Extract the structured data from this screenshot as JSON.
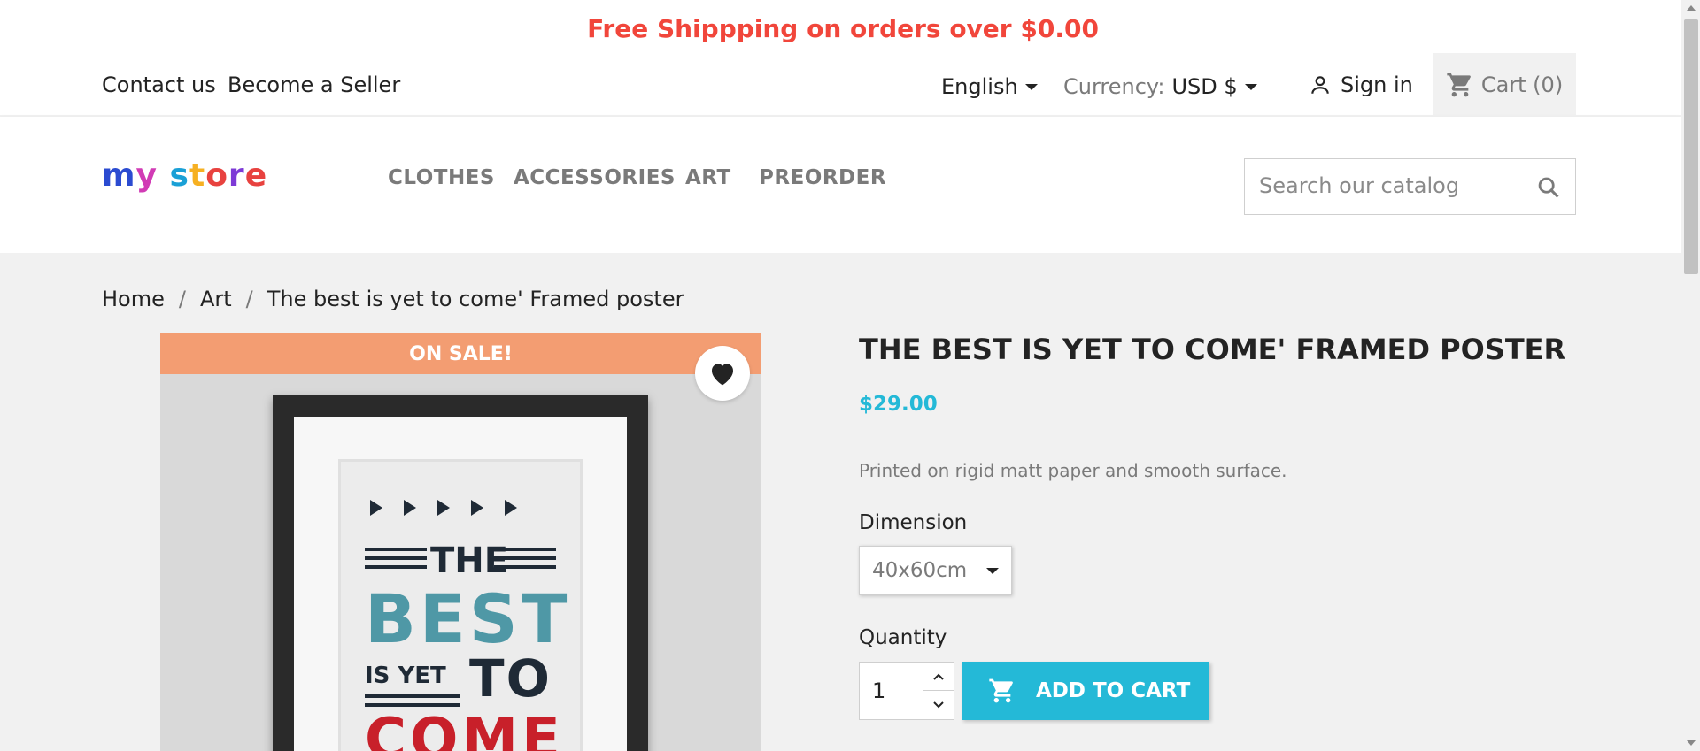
{
  "banner": {
    "text": "Free Shippping on orders over $0.00",
    "color": "#f1463b"
  },
  "top_nav": {
    "links": [
      "Contact us",
      "Become a Seller"
    ],
    "language": "English",
    "currency_label": "Currency:",
    "currency_value": "USD $",
    "signin": "Sign in",
    "cart": "Cart (0)"
  },
  "header": {
    "logo": {
      "my": "my",
      "store": "store"
    },
    "menu": [
      "CLOTHES",
      "ACCESSORIES",
      "ART",
      "PREORDER"
    ],
    "search_placeholder": "Search our catalog",
    "icons": {
      "search": "search-icon",
      "user": "user-icon",
      "cart": "shopping-cart-icon"
    }
  },
  "breadcrumb": [
    "Home",
    "Art",
    "The best is yet to come' Framed poster"
  ],
  "product": {
    "flag": "ON SALE!",
    "poster": {
      "the": "THE",
      "best": "BEST",
      "is_yet": "IS YET",
      "to": "TO",
      "come": "COME"
    },
    "title": "THE BEST IS YET TO COME' FRAMED POSTER",
    "price": "$29.00",
    "description": "Printed on rigid matt paper and smooth surface.",
    "dimension_label": "Dimension",
    "dimension_value": "40x60cm",
    "quantity_label": "Quantity",
    "quantity_value": "1",
    "add_to_cart": "ADD TO CART"
  },
  "colors": {
    "accent": "#24b9d7",
    "sale": "#f39d72",
    "banner": "#f1463b"
  }
}
